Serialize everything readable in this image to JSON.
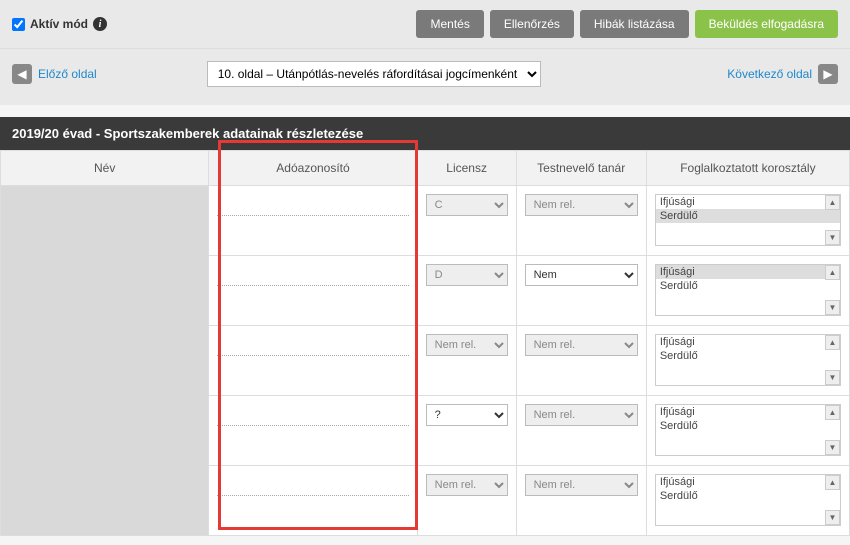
{
  "toolbar": {
    "active_mode_label": "Aktív mód",
    "save": "Mentés",
    "check": "Ellenőrzés",
    "errors": "Hibák listázása",
    "submit": "Beküldés elfogadásra"
  },
  "nav": {
    "prev": "Előző oldal",
    "next": "Következő oldal",
    "page_select": "10. oldal – Utánpótlás-nevelés ráfordításai jogcímenként"
  },
  "section_title": "2019/20 évad - Sportszakemberek adatainak részletezése",
  "columns": {
    "nev": "Név",
    "ado": "Adóazonosító",
    "licensz": "Licensz",
    "testnevelo": "Testnevelő tanár",
    "foglalkoztatott": "Foglalkoztatott korosztály"
  },
  "rows": [
    {
      "licensz": "C",
      "testnevelo": "Nem rel.",
      "testnevelo_enabled": false,
      "kor": [
        "Ifjúsági",
        "Serdülő"
      ],
      "kor_sel": [
        1
      ]
    },
    {
      "licensz": "D",
      "testnevelo": "Nem",
      "testnevelo_enabled": true,
      "kor": [
        "Ifjúsági",
        "Serdülő"
      ],
      "kor_sel": [
        0
      ]
    },
    {
      "licensz": "Nem rel.",
      "testnevelo": "Nem rel.",
      "testnevelo_enabled": false,
      "kor": [
        "Ifjúsági",
        "Serdülő"
      ],
      "kor_sel": []
    },
    {
      "licensz": "?",
      "licensz_enabled": true,
      "testnevelo": "Nem rel.",
      "testnevelo_enabled": false,
      "kor": [
        "Ifjúsági",
        "Serdülő"
      ],
      "kor_sel": []
    },
    {
      "licensz": "Nem rel.",
      "testnevelo": "Nem rel.",
      "testnevelo_enabled": false,
      "kor": [
        "Ifjúsági",
        "Serdülő"
      ],
      "kor_sel": []
    }
  ]
}
